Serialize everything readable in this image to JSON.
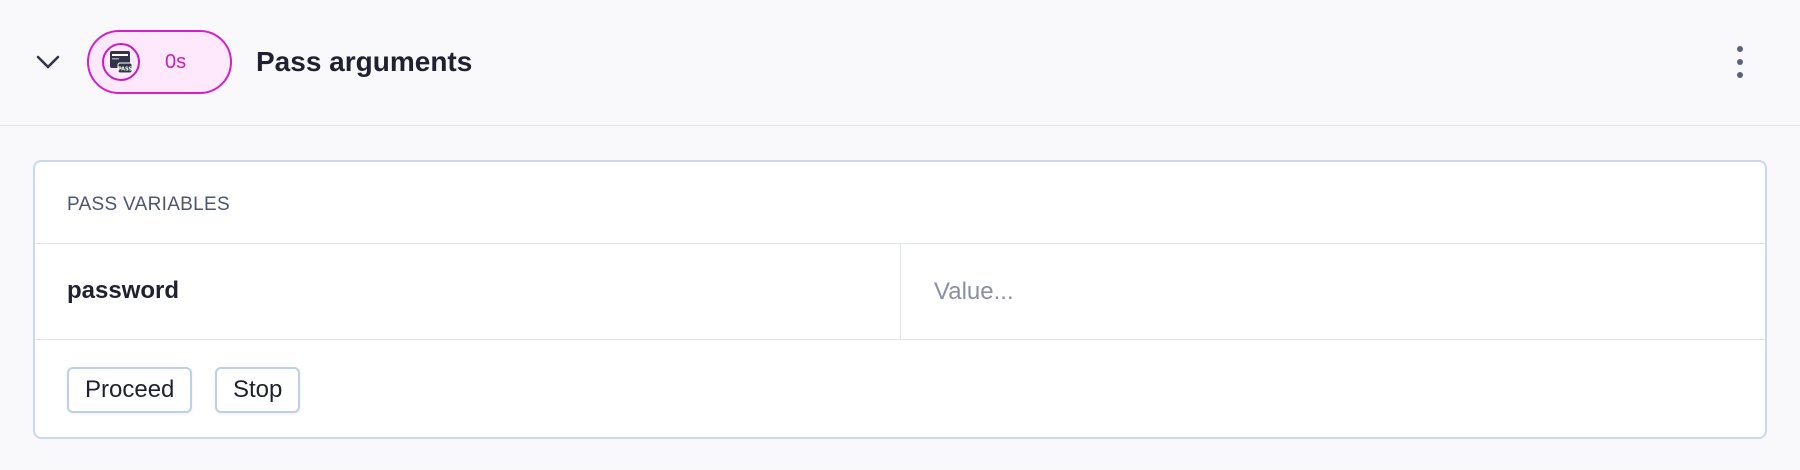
{
  "step": {
    "title": "Pass arguments",
    "duration": "0s",
    "icon": "terminal-pass-icon",
    "status_color": "#c71dbe",
    "badge_bg": "#fde9fb",
    "icon_label": "PASS"
  },
  "panel": {
    "title": "PASS VARIABLES",
    "variables": [
      {
        "name": "password",
        "value": "",
        "placeholder": "Value..."
      }
    ],
    "buttons": {
      "proceed_label": "Proceed",
      "stop_label": "Stop"
    }
  }
}
